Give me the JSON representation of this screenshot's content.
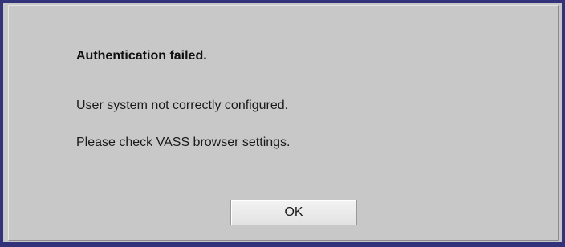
{
  "dialog": {
    "title": "Authentication failed.",
    "messages": [
      "User system not correctly configured.",
      "Please check VASS browser settings."
    ],
    "ok_label": "OK"
  },
  "colors": {
    "dialog_background": "#c8c8c8",
    "frame_border": "#33337a",
    "button_background": "#eeeeee"
  }
}
